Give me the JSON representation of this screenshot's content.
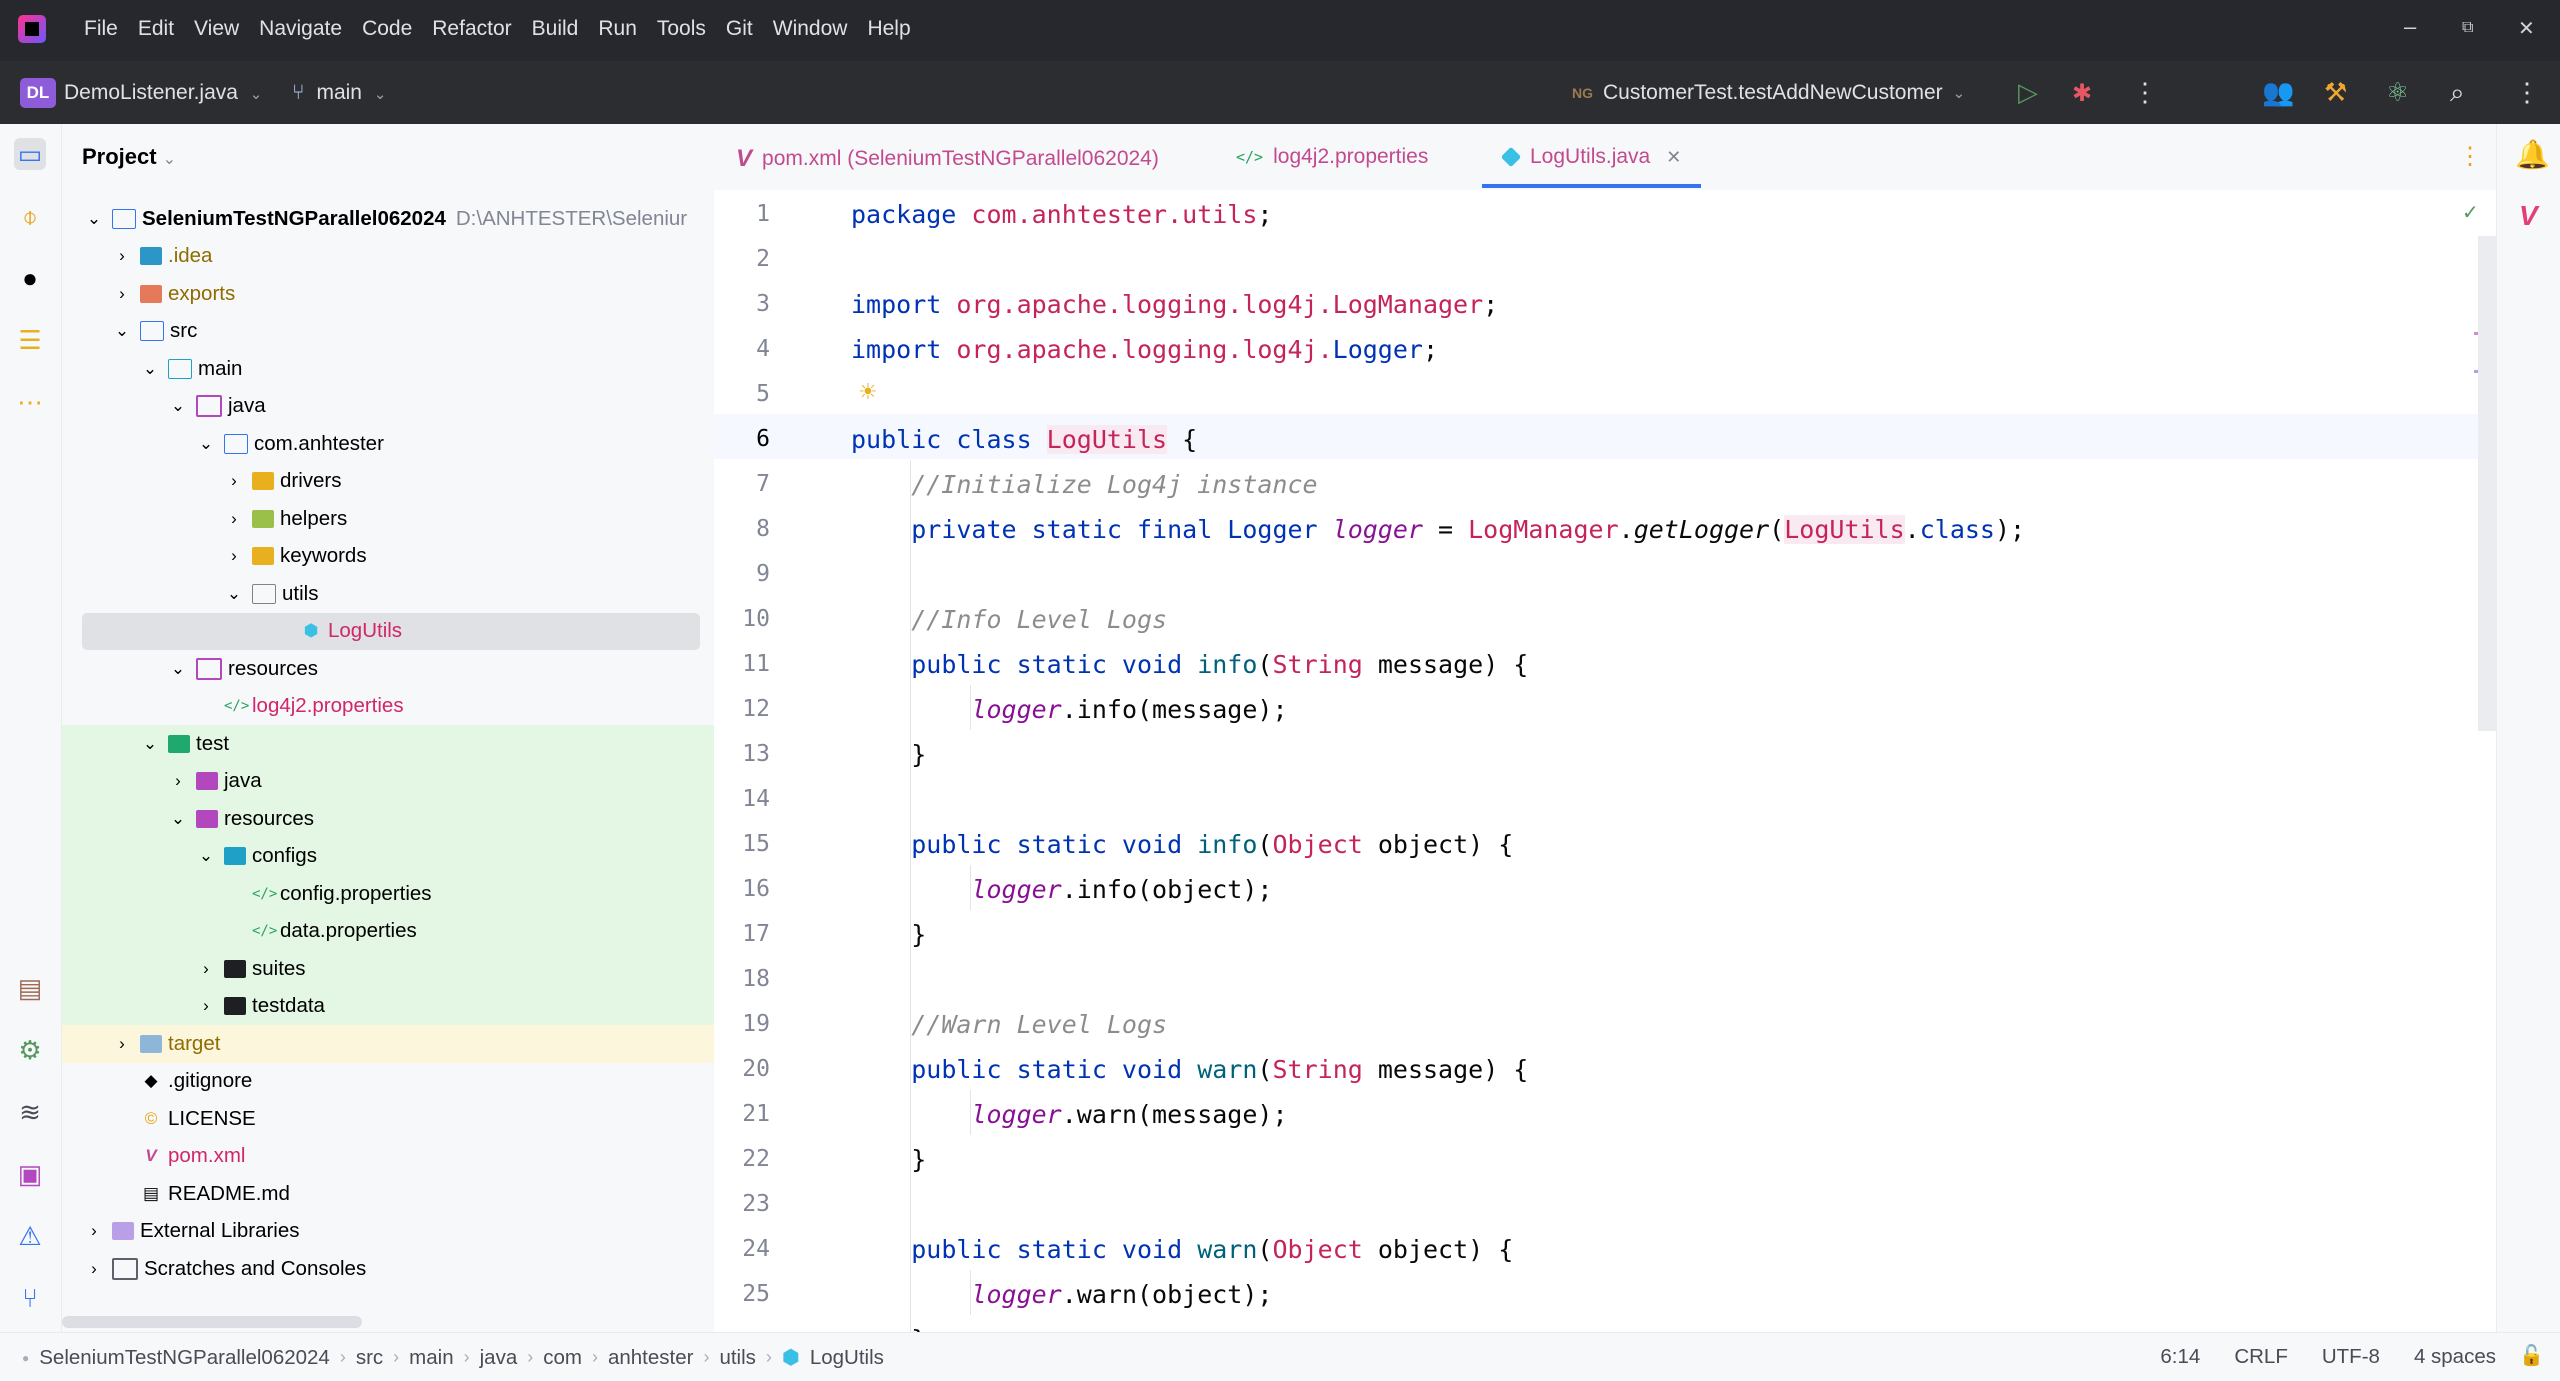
{
  "menu": [
    "File",
    "Edit",
    "View",
    "Navigate",
    "Code",
    "Refactor",
    "Build",
    "Run",
    "Tools",
    "Git",
    "Window",
    "Help"
  ],
  "window_controls": {
    "minimize": "–",
    "restore": "⧉",
    "close": "✕"
  },
  "toolbar": {
    "project_badge": "DL",
    "project_name": "DemoListener.java",
    "branch": "main",
    "run_config_prefix": "NG",
    "run_config": "CustomerTest.testAddNewCustomer"
  },
  "project_panel": {
    "title": "Project",
    "tree": [
      {
        "label": "SeleniumTestNGParallel062024",
        "extra": "D:\\ANHTESTER\\Seleniur",
        "depth": 0,
        "arrow": "open"
      },
      {
        "label": ".idea",
        "depth": 1,
        "arrow": "closed"
      },
      {
        "label": "exports",
        "depth": 1,
        "arrow": "closed"
      },
      {
        "label": "src",
        "depth": 1,
        "arrow": "open"
      },
      {
        "label": "main",
        "depth": 2,
        "arrow": "open"
      },
      {
        "label": "java",
        "depth": 3,
        "arrow": "open"
      },
      {
        "label": "com.anhtester",
        "depth": 4,
        "arrow": "open"
      },
      {
        "label": "drivers",
        "depth": 5,
        "arrow": "closed"
      },
      {
        "label": "helpers",
        "depth": 5,
        "arrow": "closed"
      },
      {
        "label": "keywords",
        "depth": 5,
        "arrow": "closed"
      },
      {
        "label": "utils",
        "depth": 5,
        "arrow": "open"
      },
      {
        "label": "LogUtils",
        "depth": 6,
        "arrow": "none"
      },
      {
        "label": "resources",
        "depth": 3,
        "arrow": "open"
      },
      {
        "label": "log4j2.properties",
        "depth": 4,
        "arrow": "none"
      },
      {
        "label": "test",
        "depth": 2,
        "arrow": "open"
      },
      {
        "label": "java",
        "depth": 3,
        "arrow": "closed"
      },
      {
        "label": "resources",
        "depth": 3,
        "arrow": "open"
      },
      {
        "label": "configs",
        "depth": 4,
        "arrow": "open"
      },
      {
        "label": "config.properties",
        "depth": 5,
        "arrow": "none"
      },
      {
        "label": "data.properties",
        "depth": 5,
        "arrow": "none"
      },
      {
        "label": "suites",
        "depth": 4,
        "arrow": "closed"
      },
      {
        "label": "testdata",
        "depth": 4,
        "arrow": "closed"
      },
      {
        "label": "target",
        "depth": 1,
        "arrow": "closed"
      },
      {
        "label": ".gitignore",
        "depth": 1,
        "arrow": "none"
      },
      {
        "label": "LICENSE",
        "depth": 1,
        "arrow": "none"
      },
      {
        "label": "pom.xml",
        "depth": 1,
        "arrow": "none"
      },
      {
        "label": "README.md",
        "depth": 1,
        "arrow": "none"
      },
      {
        "label": "External Libraries",
        "depth": 0,
        "arrow": "closed"
      },
      {
        "label": "Scratches and Consoles",
        "depth": 0,
        "arrow": "closed"
      }
    ]
  },
  "tabs": [
    {
      "label": "pom.xml (SeleniumTestNGParallel062024)",
      "active": false
    },
    {
      "label": "log4j2.properties",
      "active": false
    },
    {
      "label": "LogUtils.java",
      "active": true
    }
  ],
  "editor": {
    "lines": [
      "package com.anhtester.utils;",
      "",
      "import org.apache.logging.log4j.LogManager;",
      "import org.apache.logging.log4j.Logger;",
      "",
      "public class LogUtils {",
      "    //Initialize Log4j instance",
      "    private static final Logger logger = LogManager.getLogger(LogUtils.class);",
      "",
      "    //Info Level Logs",
      "    public static void info(String message) {",
      "        logger.info(message);",
      "    }",
      "",
      "    public static void info(Object object) {",
      "        logger.info(object);",
      "    }",
      "",
      "    //Warn Level Logs",
      "    public static void warn(String message) {",
      "        logger.warn(message);",
      "    }",
      "",
      "    public static void warn(Object object) {",
      "        logger.warn(object);",
      "    }"
    ],
    "line_numbers": [
      "1",
      "2",
      "3",
      "4",
      "5",
      "6",
      "7",
      "8",
      "9",
      "10",
      "11",
      "12",
      "13",
      "14",
      "15",
      "16",
      "17",
      "18",
      "19",
      "20",
      "21",
      "22",
      "23",
      "24",
      "25"
    ],
    "current_line": 6
  },
  "status": {
    "breadcrumb": [
      "SeleniumTestNGParallel062024",
      "src",
      "main",
      "java",
      "com",
      "anhtester",
      "utils",
      "LogUtils"
    ],
    "position": "6:14",
    "line_sep": "CRLF",
    "encoding": "UTF-8",
    "indent": "4 spaces"
  }
}
